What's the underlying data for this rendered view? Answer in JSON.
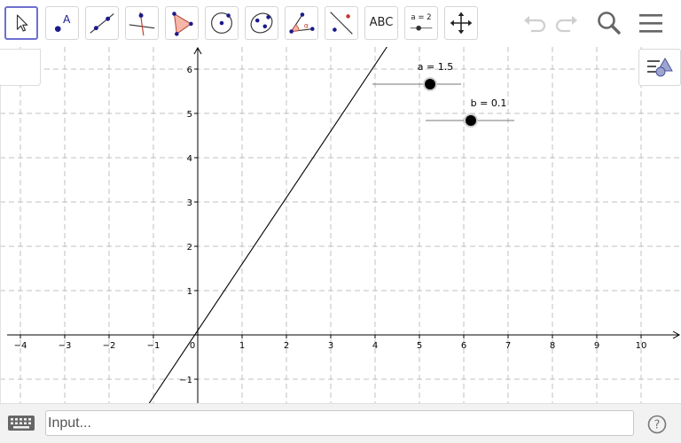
{
  "toolbar": {
    "tools": [
      {
        "id": "move",
        "icon": "cursor-arrow-icon"
      },
      {
        "id": "point",
        "icon": "point-icon",
        "label": "A"
      },
      {
        "id": "line",
        "icon": "line-through-points-icon"
      },
      {
        "id": "perpendicular",
        "icon": "perpendicular-line-icon"
      },
      {
        "id": "polygon",
        "icon": "polygon-icon"
      },
      {
        "id": "circle",
        "icon": "circle-center-point-icon"
      },
      {
        "id": "ellipse",
        "icon": "ellipse-icon"
      },
      {
        "id": "angle",
        "icon": "angle-icon",
        "label": "α"
      },
      {
        "id": "reflect",
        "icon": "reflect-about-line-icon"
      },
      {
        "id": "text",
        "icon": "text-icon",
        "label": "ABC"
      },
      {
        "id": "slider",
        "icon": "slider-icon",
        "label": "a = 2"
      },
      {
        "id": "move-graphics",
        "icon": "move-graphics-view-icon"
      }
    ],
    "right": [
      "undo-icon",
      "redo-icon",
      "search-icon",
      "menu-icon"
    ]
  },
  "graphics": {
    "x_axis": {
      "min": -4.3,
      "max": 10.9,
      "ticks": [
        "−4",
        "−3",
        "−2",
        "−1",
        "0",
        "1",
        "2",
        "3",
        "4",
        "5",
        "6",
        "7",
        "8",
        "9",
        "10"
      ]
    },
    "y_axis": {
      "min": -1.7,
      "max": 6.3,
      "ticks": [
        "−1",
        "1",
        "2",
        "3",
        "4",
        "5",
        "6"
      ]
    },
    "grid": true,
    "line": {
      "slope": 1.5,
      "intercept": 0.1
    },
    "sliders": [
      {
        "name": "a",
        "label": "a = 1.5",
        "value": 1.5,
        "min": -5,
        "max": 5
      },
      {
        "name": "b",
        "label": "b = 0.1",
        "value": 0.1,
        "min": -5,
        "max": 5
      }
    ]
  },
  "input_bar": {
    "placeholder": "Input...",
    "value": ""
  },
  "colors": {
    "accent": "#6e6fd0",
    "point": "#1a1a8c",
    "grid": "#c0c0c0",
    "axes": "#000000"
  }
}
